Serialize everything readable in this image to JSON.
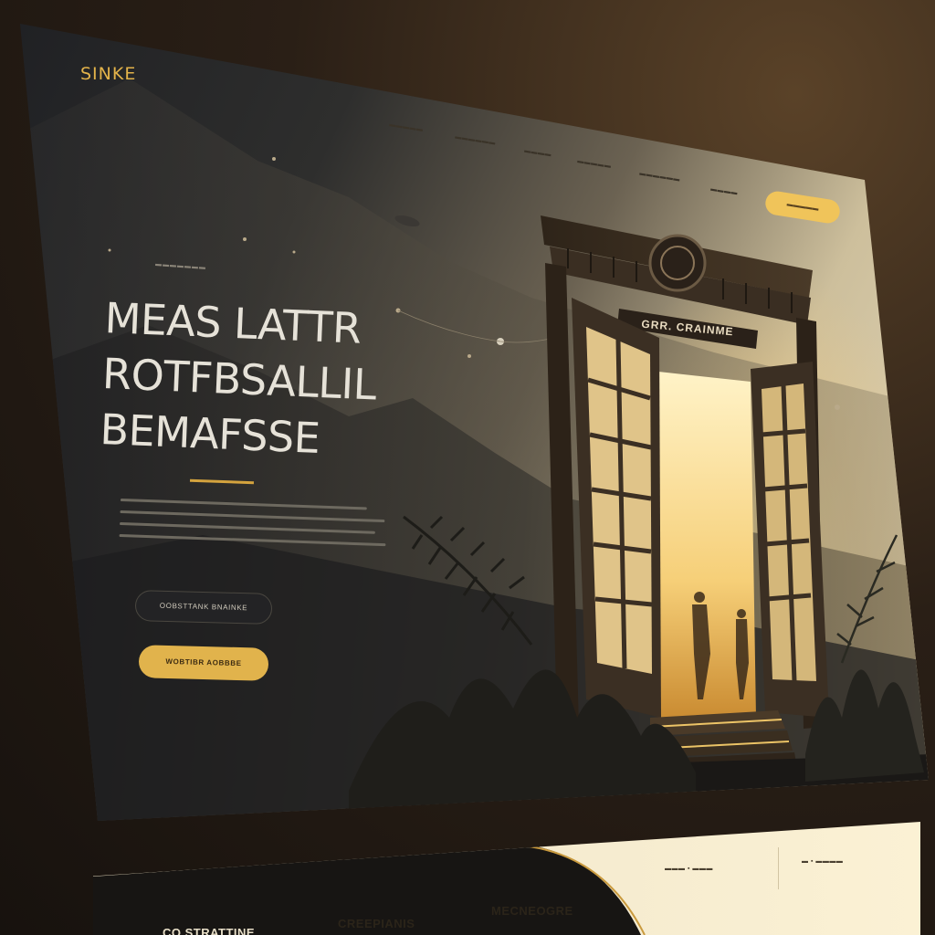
{
  "brand": {
    "logo_text": "SINKE",
    "accent": "#e1b34c"
  },
  "nav": {
    "items": [
      "▬▬▬▬▬",
      "▬▬▬▬▬▬",
      "▬▬▬▬",
      "▬▬▬▬▬",
      "▬▬▬▬▬▬",
      "▬▬▬▬"
    ],
    "cta_label": "▬▬▬▬▬"
  },
  "hero": {
    "eyebrow": "▬▬▬▬▬▬▬",
    "headline": [
      "MEAS LATTR",
      "ROTFBSALLIL",
      "BEMAFSSE"
    ],
    "primary_button": "OOBSTTANK BNAINKE",
    "secondary_button": "WOBTIBR AOBBBE",
    "door_sign": "GRR. CRAINME"
  },
  "lower": {
    "links": [
      "▬▬▬ ▪ ▬▬▬",
      "▬ ▪ ▬▬▬▬"
    ],
    "headings": [
      "CO STRATTINE",
      "CREEPIANIS",
      "MECNEOGRE"
    ]
  }
}
